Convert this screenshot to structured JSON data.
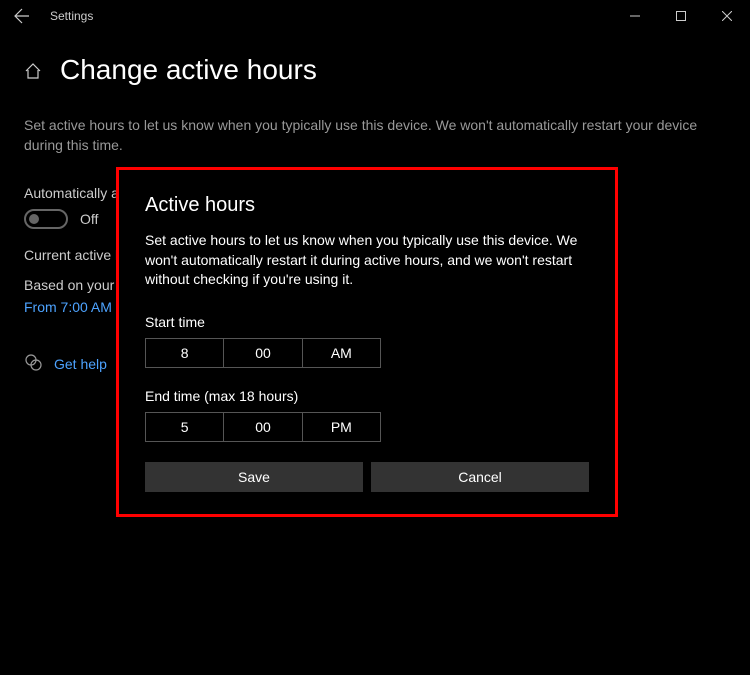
{
  "titlebar": {
    "title": "Settings"
  },
  "page": {
    "title": "Change active hours",
    "description": "Set active hours to let us know when you typically use this device. We won't automatically restart your device during this time.",
    "auto_adjust_label": "Automatically a",
    "toggle_label": "Off",
    "current_hours_label": "Current active h",
    "based_on_label": "Based on your a",
    "time_range_link": "From 7:00 AM",
    "help_label": "Get help"
  },
  "dialog": {
    "title": "Active hours",
    "description": "Set active hours to let us know when you typically use this device. We won't automatically restart it during active hours, and we won't restart without checking if you're using it.",
    "start_label": "Start time",
    "start": {
      "hour": "8",
      "minute": "00",
      "ampm": "AM"
    },
    "end_label": "End time (max 18 hours)",
    "end": {
      "hour": "5",
      "minute": "00",
      "ampm": "PM"
    },
    "save_label": "Save",
    "cancel_label": "Cancel"
  }
}
